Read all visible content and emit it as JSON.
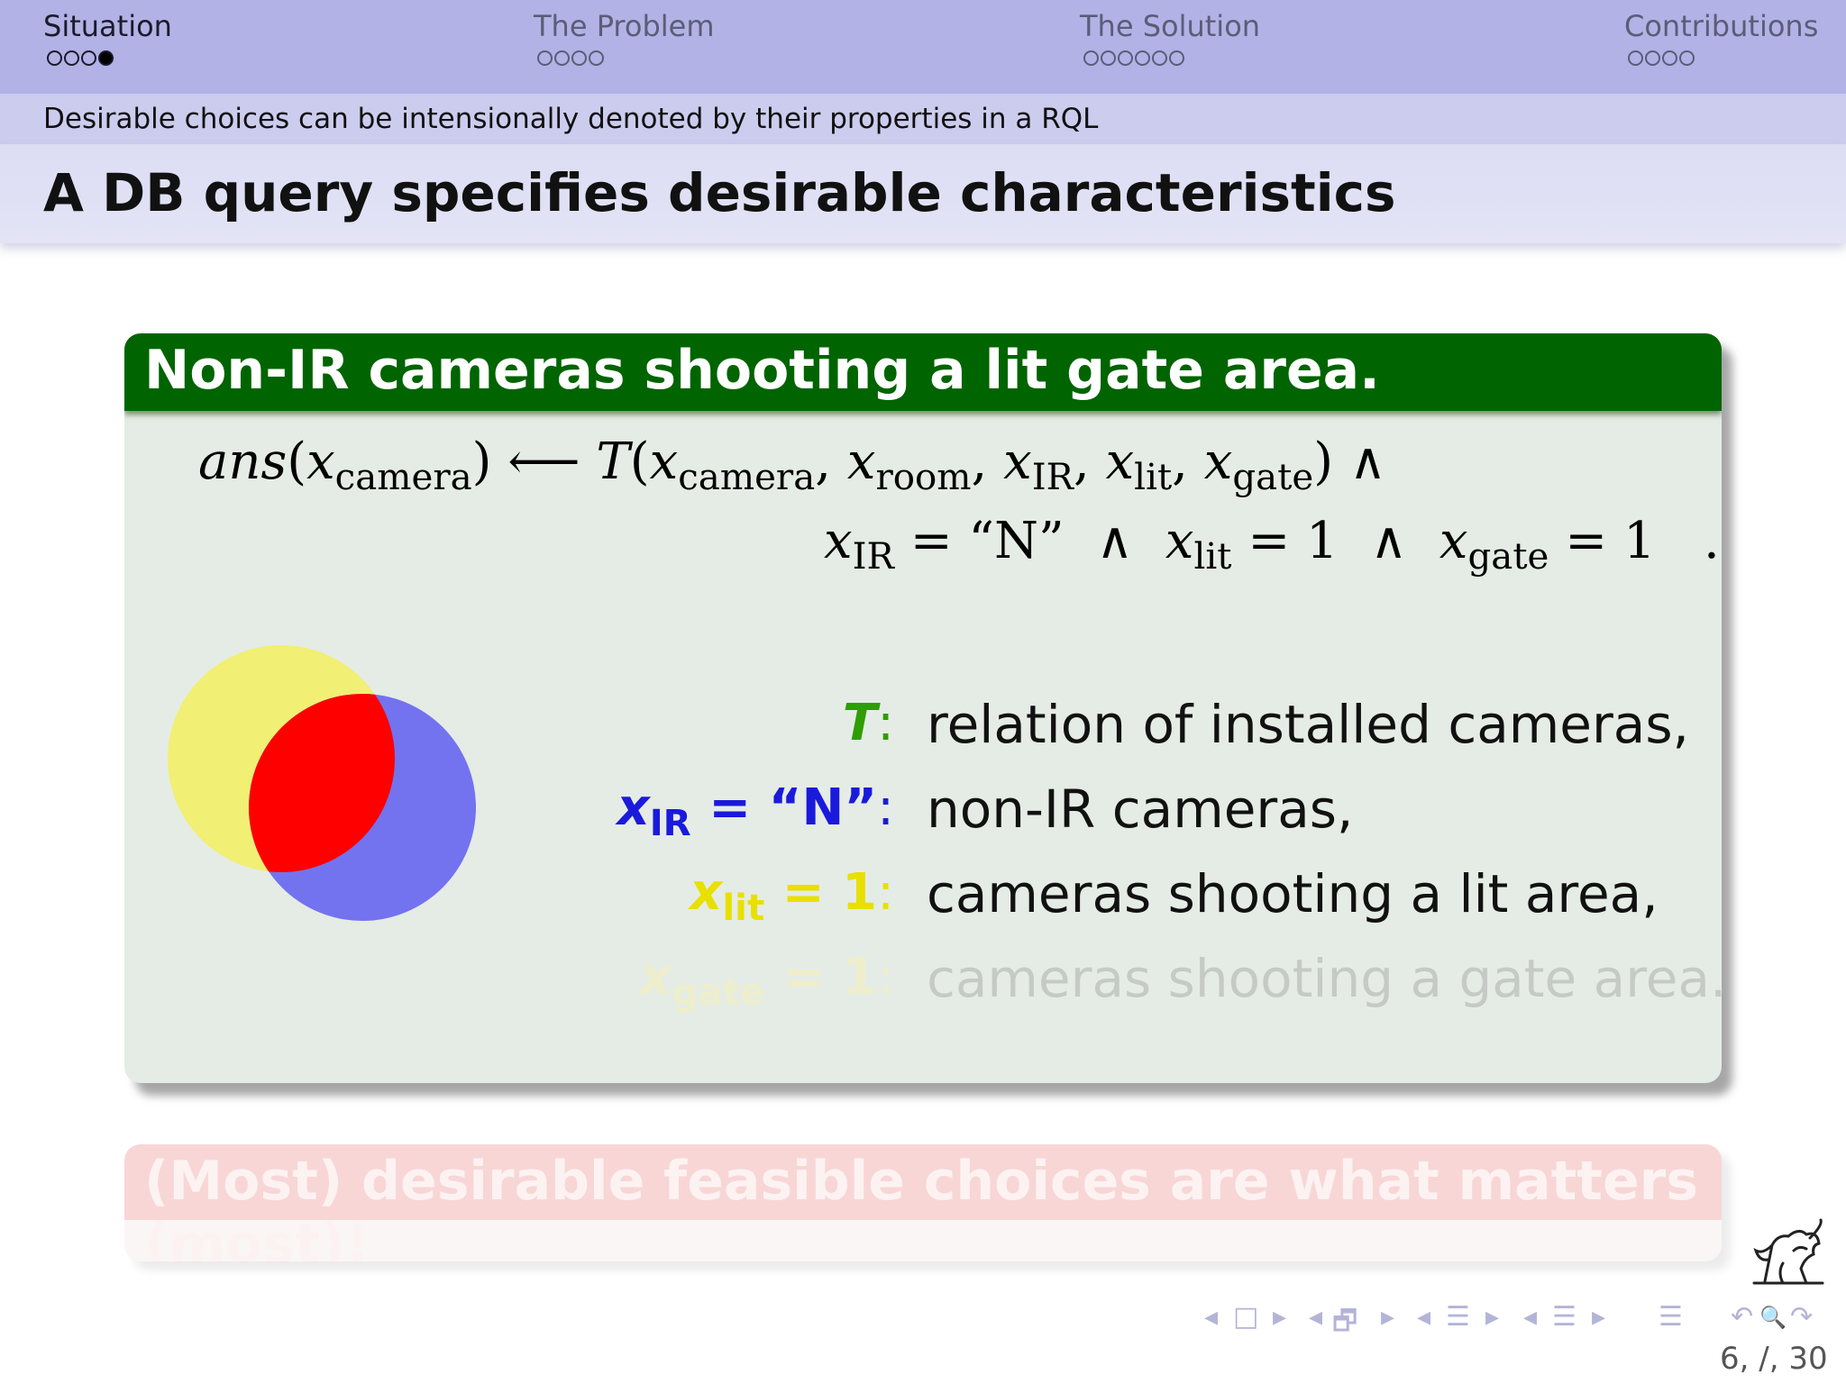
{
  "nav": {
    "sections": [
      {
        "label": "Situation",
        "dots": 4,
        "filled_index": 3,
        "active": true
      },
      {
        "label": "The Problem",
        "dots": 4,
        "filled_index": -1,
        "active": false
      },
      {
        "label": "The Solution",
        "dots": 6,
        "filled_index": -1,
        "active": false
      },
      {
        "label": "Contributions",
        "dots": 4,
        "filled_index": -1,
        "active": false
      }
    ]
  },
  "subtitle": "Desirable choices can be intensionally denoted by their properties in a RQL",
  "frame_title": "A DB query specifies desirable characteristics",
  "example_block": {
    "title": "Non-IR cameras shooting a lit gate area.",
    "query": {
      "head_fn": "ans",
      "var": "x",
      "sub_camera": "camera",
      "sub_room": "room",
      "sub_ir": "IR",
      "sub_lit": "lit",
      "sub_gate": "gate",
      "arrow": "⟵",
      "relation": "T",
      "and": "∧",
      "eq": "=",
      "val_ir": "“N”",
      "val_lit": "1",
      "val_gate": "1",
      "end": "."
    },
    "legend": [
      {
        "label_main": "T",
        "label_sub": "",
        "label_rhs": "",
        "colon": ":",
        "text": "relation of installed cameras,",
        "color": "#2e9e00"
      },
      {
        "label_main": "x",
        "label_sub": "IR",
        "label_rhs": " = “N”",
        "colon": ":",
        "text": "non-IR cameras,",
        "color": "#1a1adc"
      },
      {
        "label_main": "x",
        "label_sub": "lit",
        "label_rhs": " = 1",
        "colon": ":",
        "text": "cameras shooting a lit area,",
        "color": "#e8e000"
      },
      {
        "label_main": "x",
        "label_sub": "gate",
        "label_rhs": " = 1",
        "colon": ":",
        "text": "cameras shooting a gate area.",
        "color": "#eeeecc"
      }
    ],
    "venn_colors": {
      "yellow": "#f1ef74",
      "blue": "#7373f0",
      "intersection": "#ff0000"
    }
  },
  "faded_block": {
    "title": "(Most) desirable feasible choices are what matters (most)!"
  },
  "footer": {
    "nav_symbols": [
      "◂",
      "□",
      "▸",
      "◂",
      "🗗",
      "▸",
      "◂",
      "☰",
      "▸",
      "◂",
      "☰",
      "▸",
      "☰",
      "↶",
      "🔍",
      "↷"
    ],
    "page_label": "6, /, 30"
  }
}
